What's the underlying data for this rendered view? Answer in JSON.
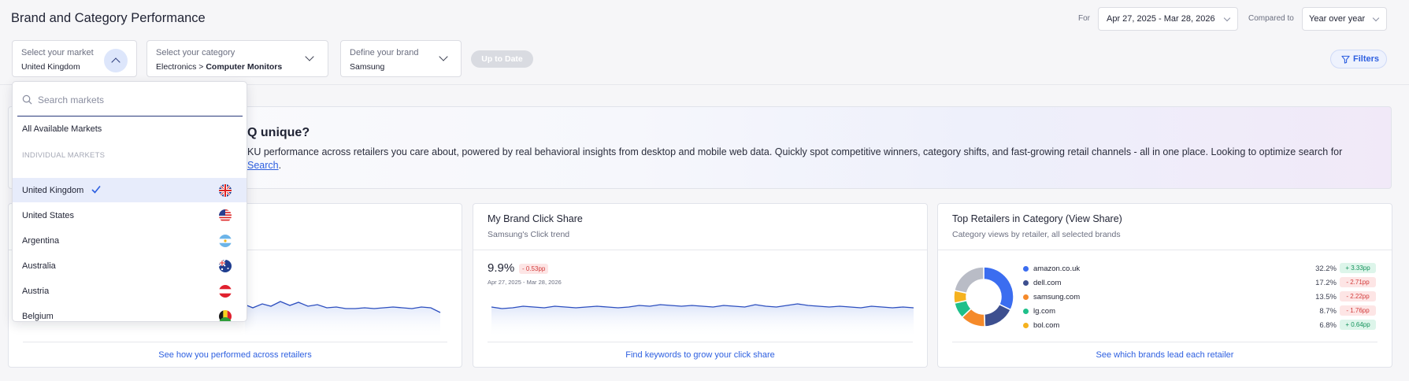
{
  "header": {
    "title": "Brand and Category Performance",
    "for_label": "For",
    "date_range": "Apr 27, 2025 - Mar 28, 2026",
    "compared_label": "Compared to",
    "compared_value": "Year over year"
  },
  "selectors": {
    "market": {
      "label": "Select your market",
      "value": "United Kingdom"
    },
    "category": {
      "label": "Select your category",
      "value_prefix": "Electronics > ",
      "value_bold": "Computer Monitors"
    },
    "brand": {
      "label": "Define your brand",
      "value": "Samsung"
    },
    "up_to_date": "Up to Date",
    "filters": "Filters"
  },
  "banner": {
    "title": "Q unique?",
    "body": "KU performance across retailers you care about, powered by real behavioral insights from desktop and mobile web data. Quickly spot competitive winners, category shifts, and fast-growing retail channels - all in one place. Looking to optimize search for",
    "link": "Search",
    "link_suffix": "."
  },
  "cards": {
    "left": {
      "link": "See how you performed across retailers"
    },
    "middle": {
      "title": "My Brand Click Share",
      "subtitle": "Samsung's Click trend",
      "metric": "9.9%",
      "delta": "- 0.53pp",
      "date_range": "Apr 27, 2025 - Mar 28, 2026",
      "link": "Find keywords to grow your click share"
    },
    "right": {
      "title": "Top Retailers in Category (View Share)",
      "subtitle": "Category views by retailer, all selected brands",
      "link": "See which brands lead each retailer",
      "retailers": [
        {
          "name": "amazon.co.uk",
          "pct": "32.2%",
          "delta": "+ 3.33pp",
          "dir": "pos",
          "color": "#3b6df0"
        },
        {
          "name": "dell.com",
          "pct": "17.2%",
          "delta": "- 2.71pp",
          "dir": "neg",
          "color": "#3d4f8f"
        },
        {
          "name": "samsung.com",
          "pct": "13.5%",
          "delta": "- 2.22pp",
          "dir": "neg",
          "color": "#f58a2a"
        },
        {
          "name": "lg.com",
          "pct": "8.7%",
          "delta": "- 1.76pp",
          "dir": "neg",
          "color": "#1fc08a"
        },
        {
          "name": "bol.com",
          "pct": "6.8%",
          "delta": "+ 0.64pp",
          "dir": "pos",
          "color": "#f5b21f"
        }
      ]
    }
  },
  "dropdown": {
    "search_placeholder": "Search markets",
    "all_markets": "All Available Markets",
    "section_header": "INDIVIDUAL MARKETS",
    "markets": [
      {
        "name": "United Kingdom",
        "selected": true,
        "flag": "uk-flag-icon"
      },
      {
        "name": "United States",
        "selected": false,
        "flag": "us-flag-icon"
      },
      {
        "name": "Argentina",
        "selected": false,
        "flag": "argentina-flag-icon"
      },
      {
        "name": "Australia",
        "selected": false,
        "flag": "australia-flag-icon"
      },
      {
        "name": "Austria",
        "selected": false,
        "flag": "austria-flag-icon"
      },
      {
        "name": "Belgium",
        "selected": false,
        "flag": "belgium-flag-icon"
      }
    ]
  },
  "colors": {
    "accent": "#2d5fe0",
    "line": "#2d4fbf",
    "selected_bg": "#e7ecfb"
  }
}
